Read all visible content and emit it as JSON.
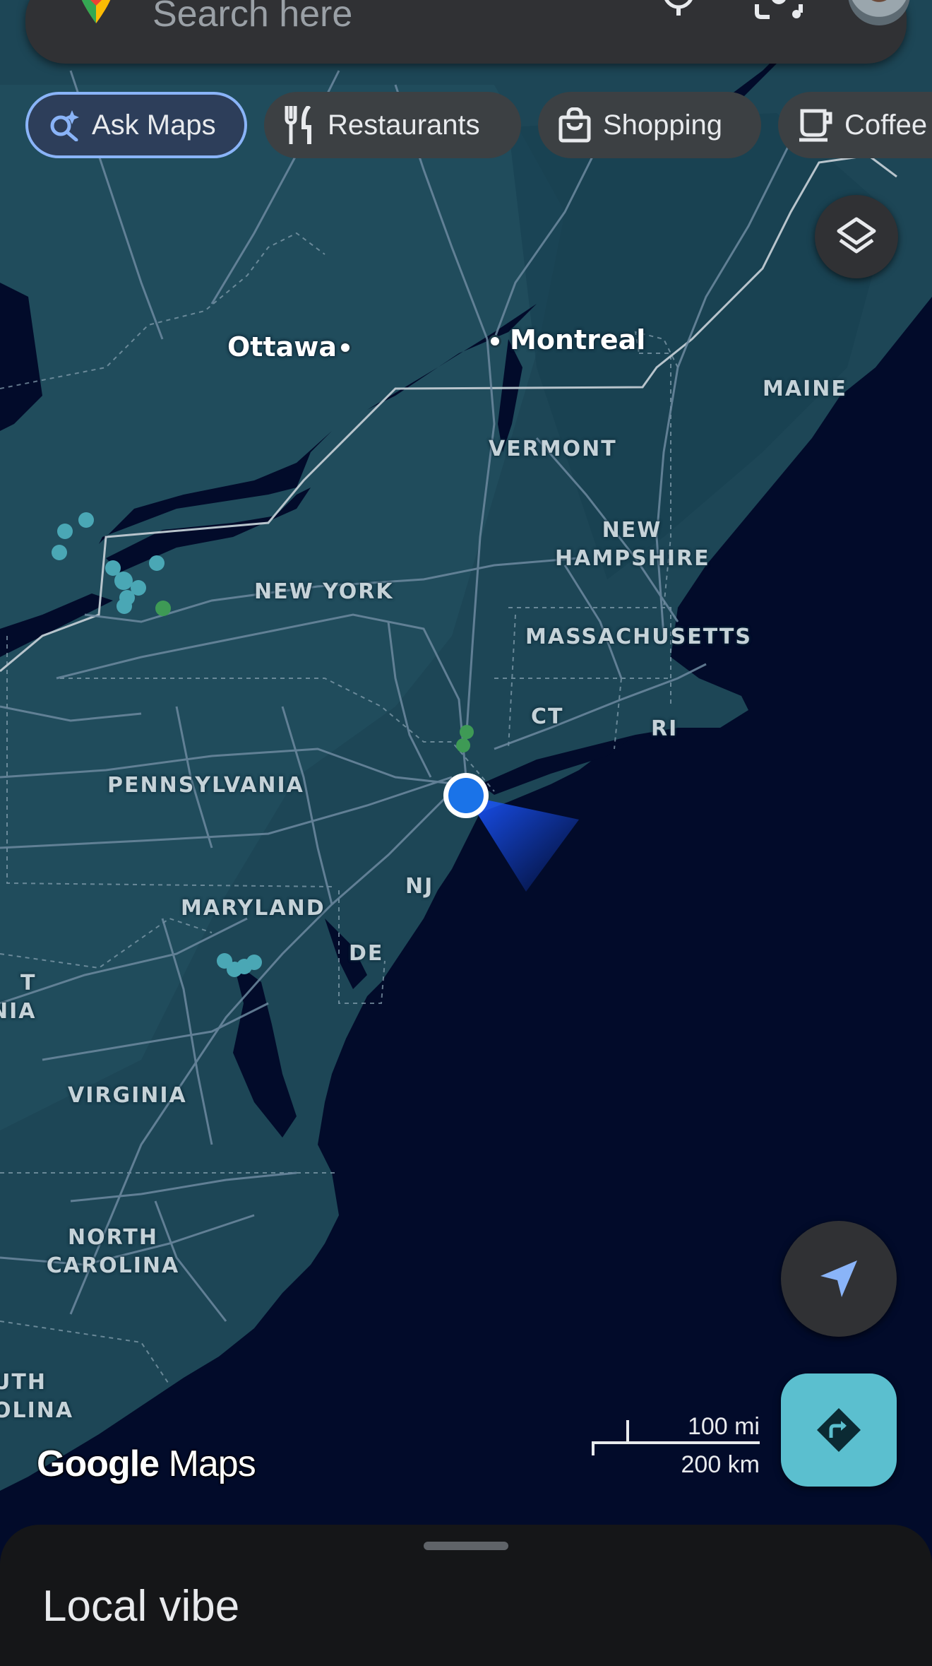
{
  "search": {
    "placeholder": "Search here",
    "icons": [
      "maps-pin-icon",
      "microphone-icon",
      "lens-icon"
    ]
  },
  "chips": [
    {
      "label": "Ask Maps",
      "icon": "sparkle-search-icon"
    },
    {
      "label": "Restaurants",
      "icon": "fork-knife-icon"
    },
    {
      "label": "Shopping",
      "icon": "shopping-bag-icon"
    },
    {
      "label": "Coffee",
      "icon": "coffee-cup-icon"
    }
  ],
  "map": {
    "cities": [
      "Ottawa",
      "Montreal"
    ],
    "regions": {
      "maine": "MAINE",
      "vermont": "VERMONT",
      "new_hampshire": [
        "NEW",
        "HAMPSHIRE"
      ],
      "new_york": "NEW YORK",
      "massachusetts": "MASSACHUSETTS",
      "ct": "CT",
      "ri": "RI",
      "pennsylvania": "PENNSYLVANIA",
      "nj": "NJ",
      "maryland": "MARYLAND",
      "de": "DE",
      "west_virginia_partial": [
        "T",
        "NIA"
      ],
      "virginia": "VIRGINIA",
      "north_carolina": [
        "NORTH",
        "CAROLINA"
      ],
      "south_carolina_partial": [
        "UTH",
        "OLINA"
      ]
    },
    "colors": {
      "land": "#1d4656",
      "water": "#020b2a",
      "roads": "#6d8aa0",
      "location": "#1a73e8"
    }
  },
  "scale": {
    "mi": "100 mi",
    "km": "200 km"
  },
  "branding": {
    "google": "Google",
    "maps": "Maps"
  },
  "buttons": {
    "layers_icon": "layers-icon",
    "locate_icon": "navigation-arrow-icon",
    "directions_icon": "directions-icon"
  },
  "sheet": {
    "title": "Local vibe"
  }
}
